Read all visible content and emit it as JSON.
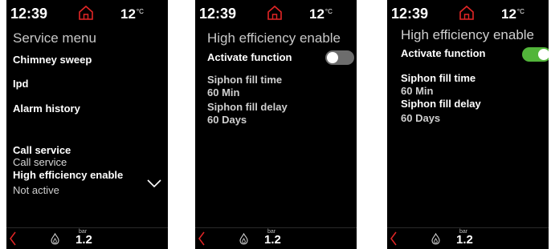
{
  "status": {
    "time": "12:39",
    "temperature": "12",
    "temperature_unit": "°C"
  },
  "footer": {
    "pressure": "1.2",
    "pressure_unit": "bar"
  },
  "colors": {
    "accent_red": "#e32626",
    "toggle_on": "#52b53a",
    "toggle_off": "#6d6d6d",
    "background": "#000000"
  },
  "screen1": {
    "title": "Service menu",
    "items": [
      {
        "label": "Chimney sweep"
      },
      {
        "label": "Ipd"
      },
      {
        "label": "Alarm history"
      },
      {
        "label": "Call service",
        "value": "Call service"
      },
      {
        "label": "High efficiency enable",
        "value": "Not active"
      }
    ]
  },
  "screen2": {
    "title": "High efficiency enable",
    "activate_label": "Activate function",
    "activate_state": "off",
    "fill_time_label": "Siphon fill time",
    "fill_time_value": "60 Min",
    "fill_delay_label": "Siphon fill delay",
    "fill_delay_value": "60 Days"
  },
  "screen3": {
    "title": "High efficiency enable",
    "activate_label": "Activate function",
    "activate_state": "on",
    "fill_time_label": "Siphon fill time",
    "fill_time_value": "60 Min",
    "fill_delay_label": "Siphon fill delay",
    "fill_delay_value": "60 Days"
  },
  "icons": {
    "status": [
      "home-icon"
    ],
    "footer": [
      "back-arrow-icon",
      "flame-icon"
    ],
    "menu": [
      "chevron-down-icon"
    ]
  }
}
